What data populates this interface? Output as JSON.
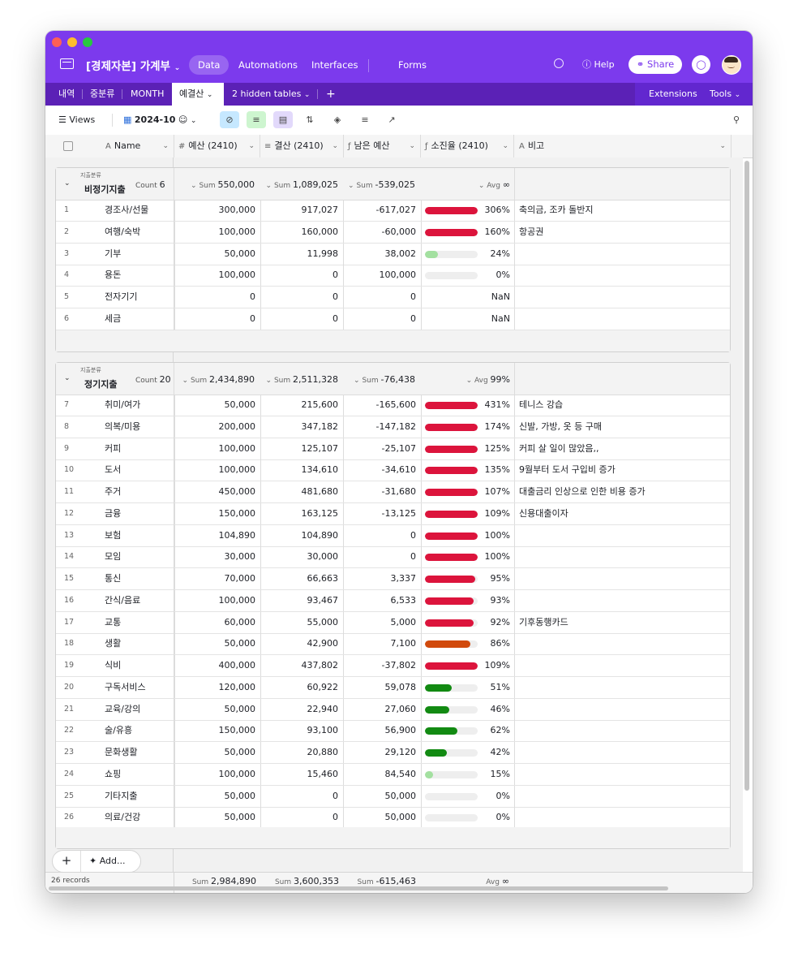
{
  "app": {
    "base_name": "[경제자본] 가계부",
    "nav": [
      "Data",
      "Automations",
      "Interfaces",
      "Forms"
    ],
    "help": "Help",
    "share": "Share"
  },
  "tables": {
    "tabs": [
      "내역",
      "중분류",
      "MONTH",
      "예결산"
    ],
    "active": "예결산",
    "hidden": "2 hidden tables",
    "extensions": "Extensions",
    "tools": "Tools"
  },
  "toolbar": {
    "views": "Views",
    "view_name": "2024-10"
  },
  "columns": {
    "name": "Name",
    "budget": "예산 (2410)",
    "actual": "결산 (2410)",
    "remaining": "남은 예산",
    "ratio": "소진율 (2410)",
    "memo": "비고"
  },
  "groups": [
    {
      "field": "지출분류",
      "value": "비정기지출",
      "count_label": "Count",
      "count": "6",
      "sum_label": "Sum",
      "avg_label": "Avg",
      "sum_budget": "550,000",
      "sum_actual": "1,089,025",
      "sum_remaining": "-539,025",
      "avg_ratio": "∞",
      "rows": [
        {
          "n": "1",
          "name": "경조사/선물",
          "budget": "300,000",
          "actual": "917,027",
          "remaining": "-617,027",
          "pct": "306%",
          "level": 1,
          "color": "#dc143c",
          "memo": "축의금, 조카 돌반지"
        },
        {
          "n": "2",
          "name": "여행/숙박",
          "budget": "100,000",
          "actual": "160,000",
          "remaining": "-60,000",
          "pct": "160%",
          "level": 1,
          "color": "#dc143c",
          "memo": "항공권"
        },
        {
          "n": "3",
          "name": "기부",
          "budget": "50,000",
          "actual": "11,998",
          "remaining": "38,002",
          "pct": "24%",
          "level": 0.24,
          "color": "#a3e0a0",
          "memo": ""
        },
        {
          "n": "4",
          "name": "용돈",
          "budget": "100,000",
          "actual": "0",
          "remaining": "100,000",
          "pct": "0%",
          "level": 0,
          "color": "#dc143c",
          "memo": ""
        },
        {
          "n": "5",
          "name": "전자기기",
          "budget": "0",
          "actual": "0",
          "remaining": "0",
          "pct": "NaN",
          "level": null,
          "color": "",
          "memo": ""
        },
        {
          "n": "6",
          "name": "세금",
          "budget": "0",
          "actual": "0",
          "remaining": "0",
          "pct": "NaN",
          "level": null,
          "color": "",
          "memo": ""
        }
      ]
    },
    {
      "field": "지출분류",
      "value": "정기지출",
      "count_label": "Count",
      "count": "20",
      "sum_label": "Sum",
      "avg_label": "Avg",
      "sum_budget": "2,434,890",
      "sum_actual": "2,511,328",
      "sum_remaining": "-76,438",
      "avg_ratio": "99%",
      "rows": [
        {
          "n": "7",
          "name": "취미/여가",
          "budget": "50,000",
          "actual": "215,600",
          "remaining": "-165,600",
          "pct": "431%",
          "level": 1,
          "color": "#dc143c",
          "memo": "테니스 강습"
        },
        {
          "n": "8",
          "name": "의복/미용",
          "budget": "200,000",
          "actual": "347,182",
          "remaining": "-147,182",
          "pct": "174%",
          "level": 1,
          "color": "#dc143c",
          "memo": "신발, 가방, 옷 등 구매"
        },
        {
          "n": "9",
          "name": "커피",
          "budget": "100,000",
          "actual": "125,107",
          "remaining": "-25,107",
          "pct": "125%",
          "level": 1,
          "color": "#dc143c",
          "memo": "커피 살 일이 많았음,,"
        },
        {
          "n": "10",
          "name": "도서",
          "budget": "100,000",
          "actual": "134,610",
          "remaining": "-34,610",
          "pct": "135%",
          "level": 1,
          "color": "#dc143c",
          "memo": "9월부터 도서 구입비 증가"
        },
        {
          "n": "11",
          "name": "주거",
          "budget": "450,000",
          "actual": "481,680",
          "remaining": "-31,680",
          "pct": "107%",
          "level": 1,
          "color": "#dc143c",
          "memo": "대출금리 인상으로 인한 비용 증가"
        },
        {
          "n": "12",
          "name": "금융",
          "budget": "150,000",
          "actual": "163,125",
          "remaining": "-13,125",
          "pct": "109%",
          "level": 1,
          "color": "#dc143c",
          "memo": "신용대출이자"
        },
        {
          "n": "13",
          "name": "보험",
          "budget": "104,890",
          "actual": "104,890",
          "remaining": "0",
          "pct": "100%",
          "level": 1,
          "color": "#dc143c",
          "memo": ""
        },
        {
          "n": "14",
          "name": "모임",
          "budget": "30,000",
          "actual": "30,000",
          "remaining": "0",
          "pct": "100%",
          "level": 1,
          "color": "#dc143c",
          "memo": ""
        },
        {
          "n": "15",
          "name": "통신",
          "budget": "70,000",
          "actual": "66,663",
          "remaining": "3,337",
          "pct": "95%",
          "level": 0.95,
          "color": "#dc143c",
          "memo": ""
        },
        {
          "n": "16",
          "name": "간식/음료",
          "budget": "100,000",
          "actual": "93,467",
          "remaining": "6,533",
          "pct": "93%",
          "level": 0.93,
          "color": "#dc143c",
          "memo": ""
        },
        {
          "n": "17",
          "name": "교통",
          "budget": "60,000",
          "actual": "55,000",
          "remaining": "5,000",
          "pct": "92%",
          "level": 0.92,
          "color": "#dc143c",
          "memo": "기후동행카드"
        },
        {
          "n": "18",
          "name": "생활",
          "budget": "50,000",
          "actual": "42,900",
          "remaining": "7,100",
          "pct": "86%",
          "level": 0.86,
          "color": "#d14a0c",
          "memo": ""
        },
        {
          "n": "19",
          "name": "식비",
          "budget": "400,000",
          "actual": "437,802",
          "remaining": "-37,802",
          "pct": "109%",
          "level": 1,
          "color": "#dc143c",
          "memo": ""
        },
        {
          "n": "20",
          "name": "구독서비스",
          "budget": "120,000",
          "actual": "60,922",
          "remaining": "59,078",
          "pct": "51%",
          "level": 0.51,
          "color": "#128a12",
          "memo": ""
        },
        {
          "n": "21",
          "name": "교육/강의",
          "budget": "50,000",
          "actual": "22,940",
          "remaining": "27,060",
          "pct": "46%",
          "level": 0.46,
          "color": "#128a12",
          "memo": ""
        },
        {
          "n": "22",
          "name": "술/유흥",
          "budget": "150,000",
          "actual": "93,100",
          "remaining": "56,900",
          "pct": "62%",
          "level": 0.62,
          "color": "#128a12",
          "memo": ""
        },
        {
          "n": "23",
          "name": "문화생활",
          "budget": "50,000",
          "actual": "20,880",
          "remaining": "29,120",
          "pct": "42%",
          "level": 0.42,
          "color": "#128a12",
          "memo": ""
        },
        {
          "n": "24",
          "name": "쇼핑",
          "budget": "100,000",
          "actual": "15,460",
          "remaining": "84,540",
          "pct": "15%",
          "level": 0.15,
          "color": "#a3e0a0",
          "memo": ""
        },
        {
          "n": "25",
          "name": "기타지출",
          "budget": "50,000",
          "actual": "0",
          "remaining": "50,000",
          "pct": "0%",
          "level": 0,
          "color": "#dc143c",
          "memo": ""
        },
        {
          "n": "26",
          "name": "의료/건강",
          "budget": "50,000",
          "actual": "0",
          "remaining": "50,000",
          "pct": "0%",
          "level": 0,
          "color": "#dc143c",
          "memo": ""
        }
      ]
    }
  ],
  "footer": {
    "records": "26 records",
    "sum_label": "Sum",
    "avg_label": "Avg",
    "sum_budget": "2,984,890",
    "sum_actual": "3,600,353",
    "sum_remaining": "-615,463",
    "avg_ratio": "∞",
    "add_label": "Add..."
  }
}
